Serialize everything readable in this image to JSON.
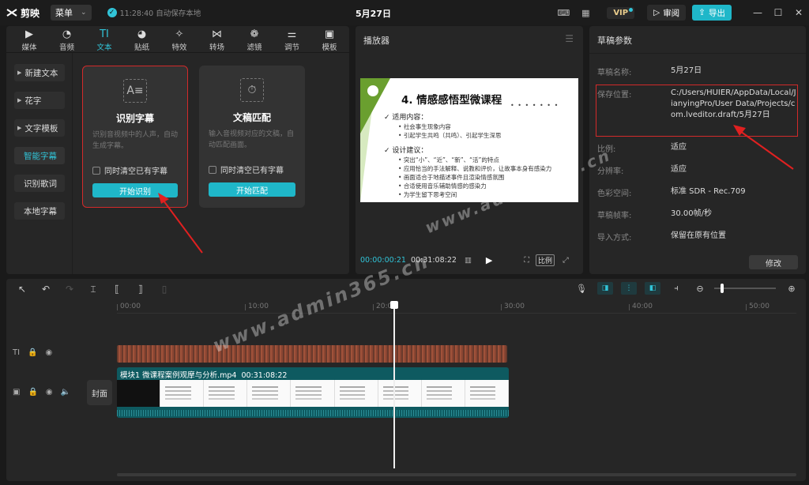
{
  "app": {
    "name": "剪映",
    "menu_label": "菜单",
    "save_status": "11:28:40 自动保存本地",
    "window_title": "5月27日"
  },
  "titlebar": {
    "vip_label": "VIP",
    "review_label": "审阅",
    "export_label": "导出"
  },
  "material_tabs": [
    {
      "label": "媒体",
      "icon": "media-icon"
    },
    {
      "label": "音频",
      "icon": "audio-icon"
    },
    {
      "label": "文本",
      "icon": "text-icon"
    },
    {
      "label": "贴纸",
      "icon": "sticker-icon"
    },
    {
      "label": "特效",
      "icon": "effects-icon"
    },
    {
      "label": "转场",
      "icon": "transition-icon"
    },
    {
      "label": "滤镜",
      "icon": "filter-icon"
    },
    {
      "label": "调节",
      "icon": "adjust-icon"
    },
    {
      "label": "模板",
      "icon": "template-icon"
    }
  ],
  "text_sidebar": [
    {
      "label": "新建文本"
    },
    {
      "label": "花字"
    },
    {
      "label": "文字模板"
    },
    {
      "label": "智能字幕"
    },
    {
      "label": "识别歌词"
    },
    {
      "label": "本地字幕"
    }
  ],
  "cards": {
    "recognize": {
      "title": "识别字幕",
      "desc": "识别音视频中的人声，自动生成字幕。",
      "checkbox": "同时清空已有字幕",
      "button": "开始识别"
    },
    "match": {
      "title": "文稿匹配",
      "desc": "输入音视频对应的文稿，自动匹配画面。",
      "checkbox": "同时清空已有字幕",
      "button": "开始匹配"
    }
  },
  "player": {
    "title": "播放器",
    "current_time": "00:00:00:21",
    "total_time": "00:31:08:22",
    "ratio_label": "比例",
    "slide": {
      "title": "4. 情感感悟型微课程",
      "section1": "适用内容：",
      "items1": [
        "社会事生现象内容",
        "引起学生共鸣（共鸣）、引起学生深思"
      ],
      "section2": "设计建议：",
      "items2": [
        "突出“小”、“近”、“新”、“活”的特点",
        "应用恰当的手法解释、说教和评价，让故事本身有感染力",
        "画面适合于地描述事件且渲染情感氛围",
        "合适使用音乐辅助情感的感染力",
        "为学生留下思考空间"
      ]
    }
  },
  "params": {
    "title": "草稿参数",
    "rows": [
      {
        "label": "草稿名称:",
        "value": "5月27日"
      },
      {
        "label": "保存位置:",
        "value": "C:/Users/HUIER/AppData/Local/JianyingPro/User Data/Projects/com.lveditor.draft/5月27日"
      },
      {
        "label": "比例:",
        "value": "适应"
      },
      {
        "label": "分辨率:",
        "value": "适应"
      },
      {
        "label": "色彩空间:",
        "value": "标准 SDR - Rec.709"
      },
      {
        "label": "草稿帧率:",
        "value": "30.00帧/秒"
      },
      {
        "label": "导入方式:",
        "value": "保留在原有位置"
      }
    ],
    "edit_label": "修改"
  },
  "timeline": {
    "ruler": [
      "00:00",
      "10:00",
      "20:00",
      "30:00",
      "40:00",
      "50:00"
    ],
    "cover_label": "封面",
    "clip_name": "模块1 微课程案例观摩与分析.mp4",
    "clip_duration": "00:31:08:22",
    "text_track_icon": "TI"
  },
  "watermark": "www.admin365.cn",
  "colors": {
    "accent": "#1fb7c9",
    "highlight": "#d22a2a",
    "panel": "#262626"
  }
}
